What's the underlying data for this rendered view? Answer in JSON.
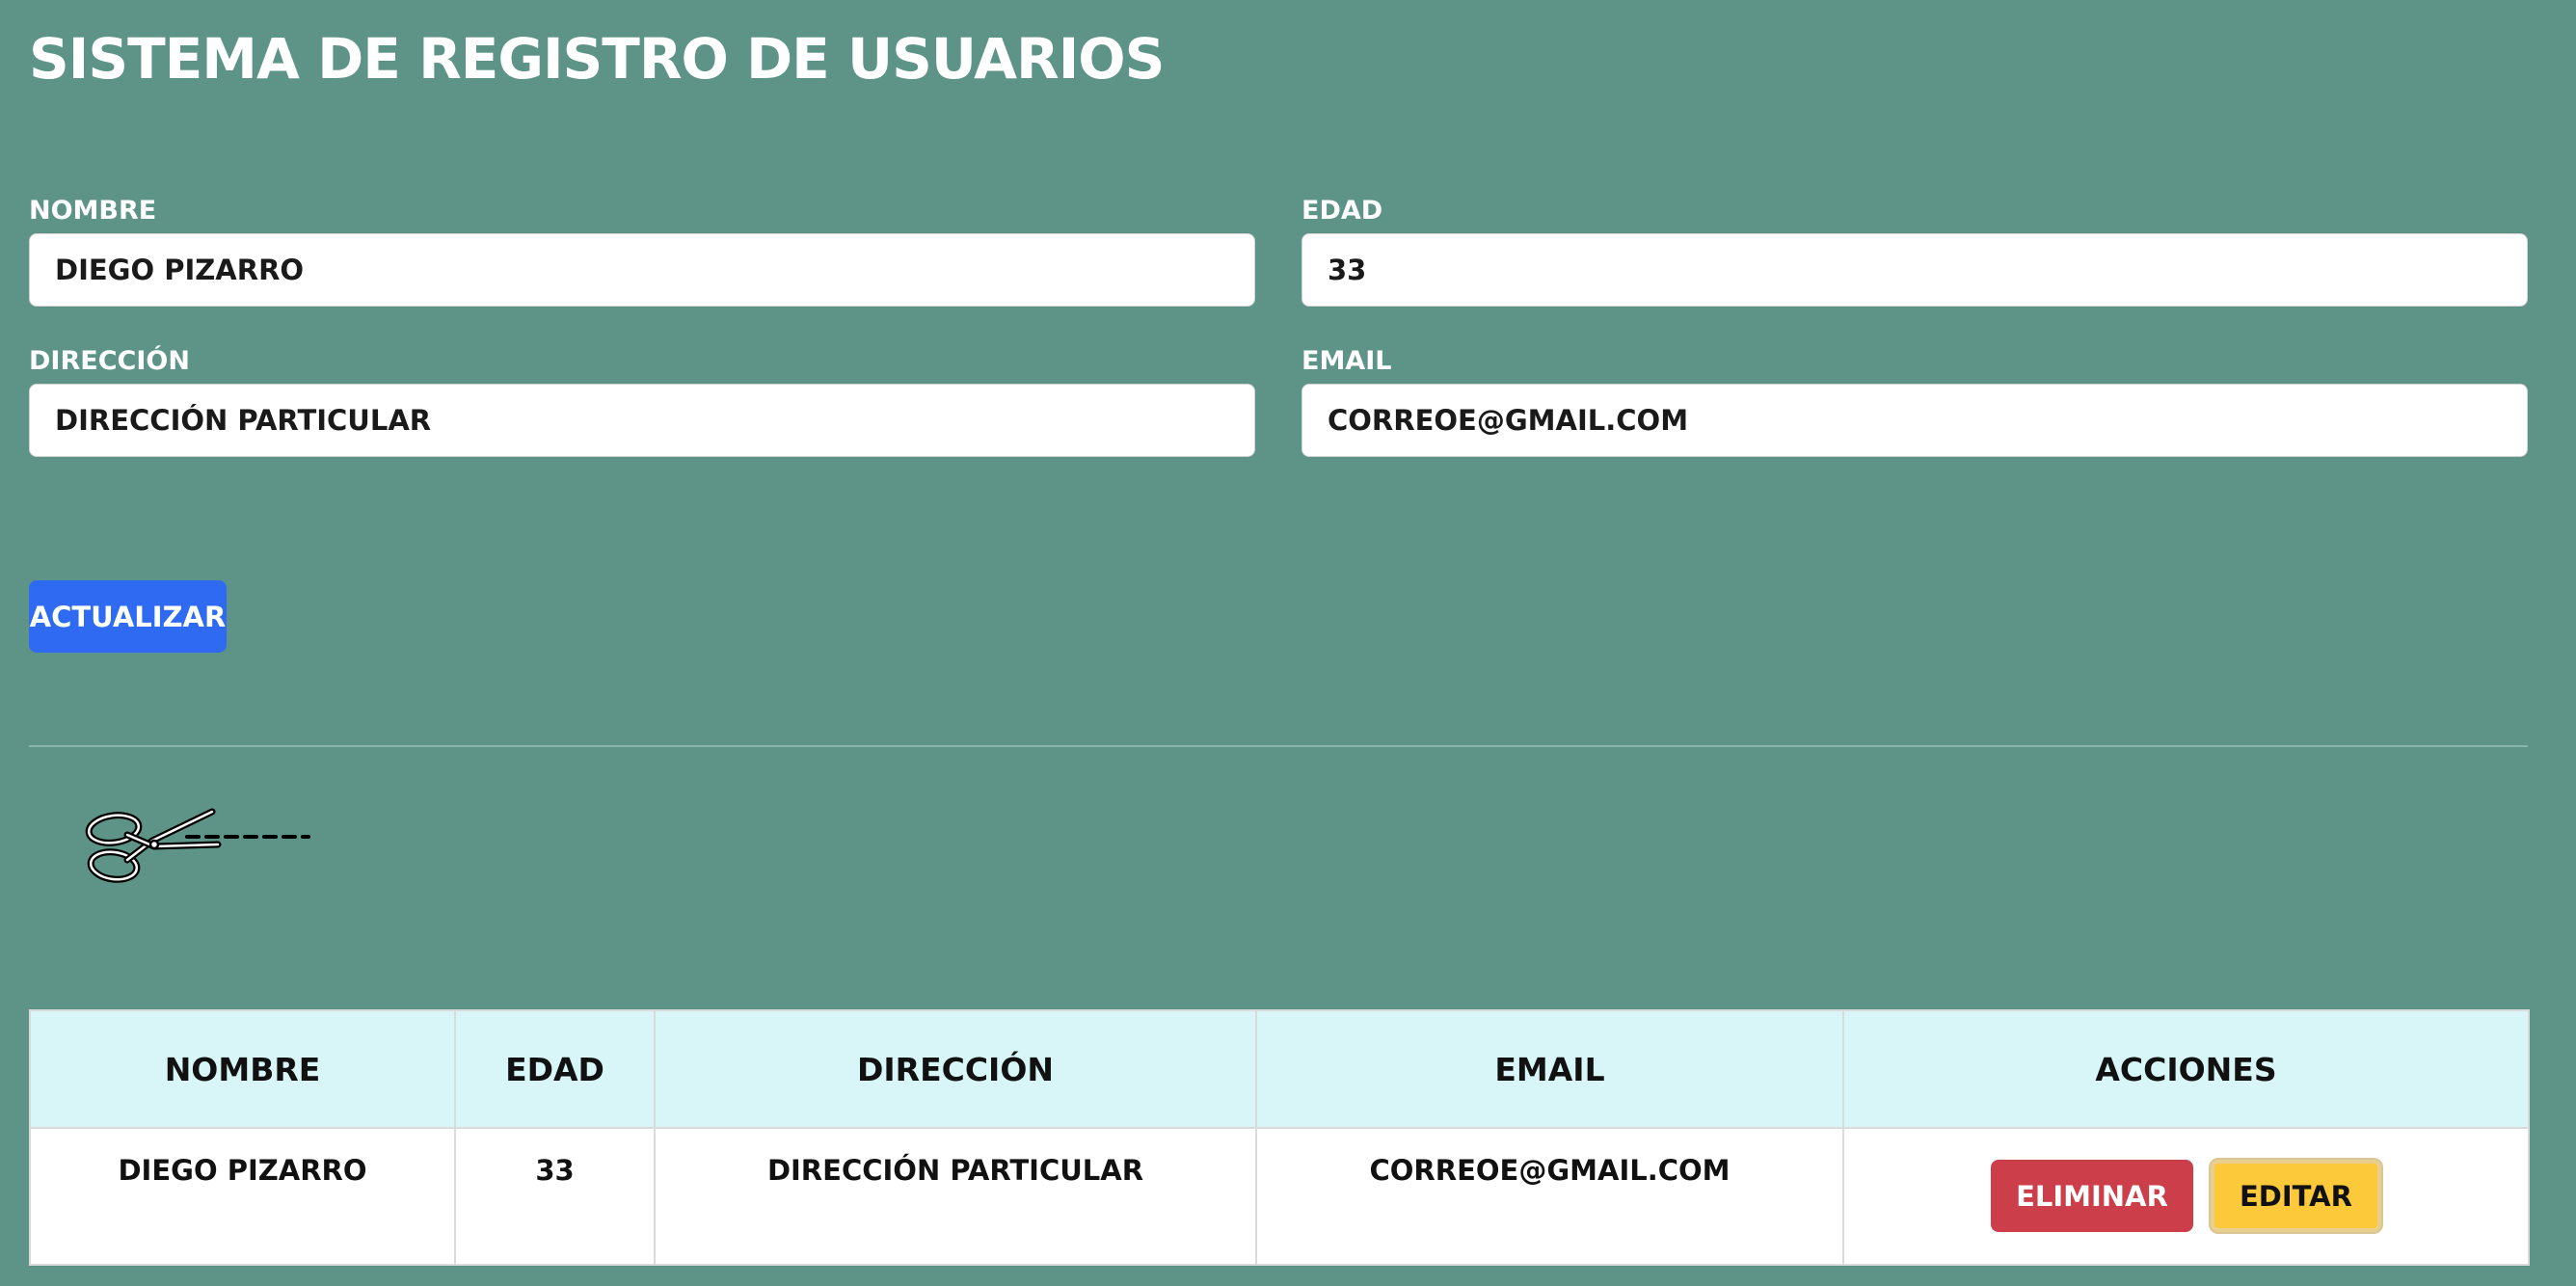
{
  "page": {
    "title": "SISTEMA DE REGISTRO DE USUARIOS"
  },
  "form": {
    "nombre": {
      "label": "NOMBRE",
      "value": "DIEGO PIZARRO"
    },
    "edad": {
      "label": "EDAD",
      "value": "33"
    },
    "direccion": {
      "label": "DIRECCIÓN",
      "value": "DIRECCIÓN PARTICULAR"
    },
    "email": {
      "label": "EMAIL",
      "value": "CORREOE@GMAIL.COM"
    },
    "submit_label": "ACTUALIZAR"
  },
  "icons": {
    "cut_line": "scissors-icon"
  },
  "table": {
    "headers": [
      "NOMBRE",
      "EDAD",
      "DIRECCIÓN",
      "EMAIL",
      "ACCIONES"
    ],
    "rows": [
      {
        "nombre": "DIEGO PIZARRO",
        "edad": "33",
        "direccion": "DIRECCIÓN PARTICULAR",
        "email": "CORREOE@GMAIL.COM",
        "actions": {
          "delete_label": "ELIMINAR",
          "edit_label": "EDITAR"
        }
      }
    ]
  },
  "colors": {
    "background": "#5e9487",
    "primary_button": "#2f6bf2",
    "danger_button": "#cc3e49",
    "warning_button": "#fcc93a",
    "table_header": "#d8f6f8"
  }
}
